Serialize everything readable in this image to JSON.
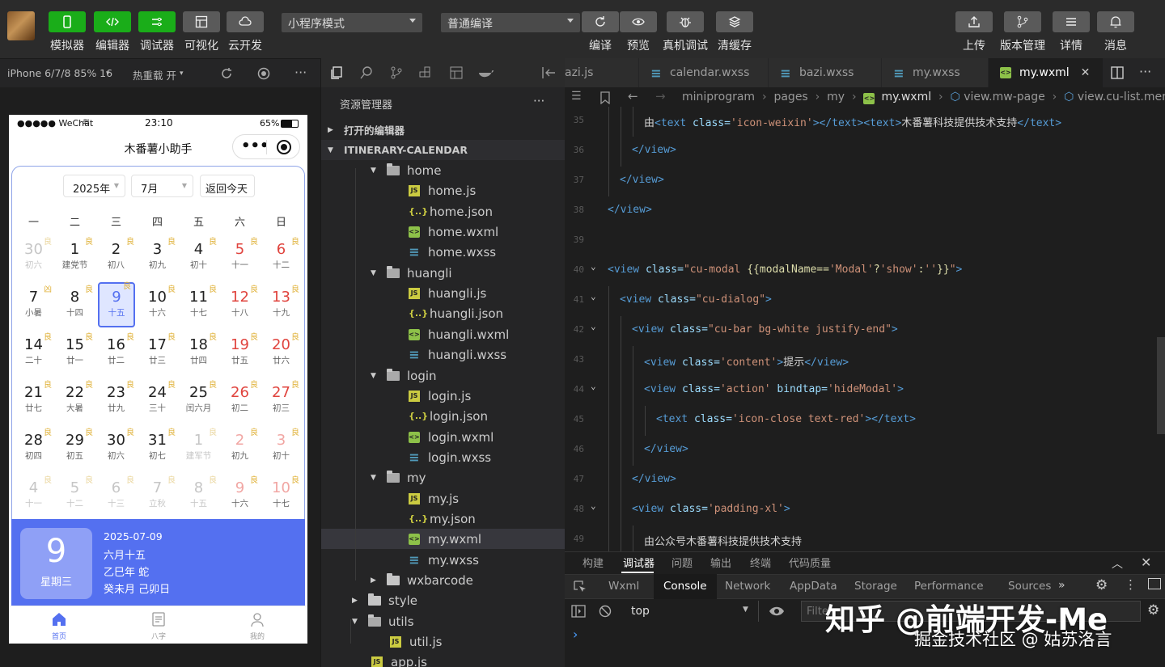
{
  "toolbar": {
    "buttons": [
      {
        "label": "模拟器",
        "icon": "phone-icon"
      },
      {
        "label": "编辑器",
        "icon": "code-icon"
      },
      {
        "label": "调试器",
        "icon": "debug-icon"
      },
      {
        "label": "可视化",
        "icon": "layout-icon"
      },
      {
        "label": "云开发",
        "icon": "cloud-icon"
      }
    ],
    "mode_select": "小程序模式",
    "compile_select": "普通编译",
    "actions": [
      {
        "label": "编译",
        "icon": "refresh-icon"
      },
      {
        "label": "预览",
        "icon": "eye-icon"
      },
      {
        "label": "真机调试",
        "icon": "bug-icon"
      },
      {
        "label": "清缓存",
        "icon": "layers-icon"
      }
    ],
    "right_actions": [
      {
        "label": "上传",
        "icon": "upload-icon"
      },
      {
        "label": "版本管理",
        "icon": "branch-icon"
      },
      {
        "label": "详情",
        "icon": "menu-icon"
      },
      {
        "label": "消息",
        "icon": "bell-icon"
      }
    ]
  },
  "simulator_bar": {
    "device": "iPhone 6/7/8 85% 16",
    "hot_reload": "热重载 开"
  },
  "phone": {
    "status": {
      "carrier": "●●●●● WeChat",
      "time": "23:10",
      "battery": "65%"
    },
    "title": "木番薯小助手",
    "year_select": "2025年",
    "month_select": "7月",
    "today_button": "返回今天",
    "weekdays": [
      "一",
      "二",
      "三",
      "四",
      "五",
      "六",
      "日"
    ],
    "weeks": [
      [
        {
          "n": "30",
          "l": "初六",
          "b": "良",
          "s": "dim"
        },
        {
          "n": "1",
          "l": "建党节",
          "b": "良"
        },
        {
          "n": "2",
          "l": "初八",
          "b": "良"
        },
        {
          "n": "3",
          "l": "初九",
          "b": "良"
        },
        {
          "n": "4",
          "l": "初十",
          "b": "良"
        },
        {
          "n": "5",
          "l": "十一",
          "b": "良",
          "s": "weekend"
        },
        {
          "n": "6",
          "l": "十二",
          "b": "良",
          "s": "weekend"
        }
      ],
      [
        {
          "n": "7",
          "l": "小暑",
          "b": "凶"
        },
        {
          "n": "8",
          "l": "十四",
          "b": "良"
        },
        {
          "n": "9",
          "l": "十五",
          "b": "良",
          "s": "sel"
        },
        {
          "n": "10",
          "l": "十六",
          "b": "良"
        },
        {
          "n": "11",
          "l": "十七",
          "b": "良"
        },
        {
          "n": "12",
          "l": "十八",
          "b": "良",
          "s": "weekend"
        },
        {
          "n": "13",
          "l": "十九",
          "b": "良",
          "s": "weekend"
        }
      ],
      [
        {
          "n": "14",
          "l": "二十",
          "b": "良"
        },
        {
          "n": "15",
          "l": "廿一",
          "b": "良"
        },
        {
          "n": "16",
          "l": "廿二",
          "b": "良"
        },
        {
          "n": "17",
          "l": "廿三",
          "b": "良"
        },
        {
          "n": "18",
          "l": "廿四",
          "b": "良"
        },
        {
          "n": "19",
          "l": "廿五",
          "b": "良",
          "s": "weekend"
        },
        {
          "n": "20",
          "l": "廿六",
          "b": "良",
          "s": "weekend"
        }
      ],
      [
        {
          "n": "21",
          "l": "廿七",
          "b": "良"
        },
        {
          "n": "22",
          "l": "大暑",
          "b": "良"
        },
        {
          "n": "23",
          "l": "廿九",
          "b": "良"
        },
        {
          "n": "24",
          "l": "三十",
          "b": "良"
        },
        {
          "n": "25",
          "l": "闰六月",
          "b": "良"
        },
        {
          "n": "26",
          "l": "初二",
          "b": "良",
          "s": "weekend"
        },
        {
          "n": "27",
          "l": "初三",
          "b": "良",
          "s": "weekend"
        }
      ],
      [
        {
          "n": "28",
          "l": "初四",
          "b": "良"
        },
        {
          "n": "29",
          "l": "初五",
          "b": "良"
        },
        {
          "n": "30",
          "l": "初六",
          "b": "良"
        },
        {
          "n": "31",
          "l": "初七",
          "b": "良"
        },
        {
          "n": "1",
          "l": "建军节",
          "b": "良",
          "s": "dim"
        },
        {
          "n": "2",
          "l": "初九",
          "b": "良",
          "s": "dimwk"
        },
        {
          "n": "3",
          "l": "初十",
          "b": "良",
          "s": "dimwk"
        }
      ],
      [
        {
          "n": "4",
          "l": "十一",
          "b": "良",
          "s": "dim"
        },
        {
          "n": "5",
          "l": "十二",
          "b": "良",
          "s": "dim"
        },
        {
          "n": "6",
          "l": "十三",
          "b": "良",
          "s": "dim"
        },
        {
          "n": "7",
          "l": "立秋",
          "b": "良",
          "s": "dim"
        },
        {
          "n": "8",
          "l": "十五",
          "b": "良",
          "s": "dim"
        },
        {
          "n": "9",
          "l": "十六",
          "b": "良",
          "s": "dimwk"
        },
        {
          "n": "10",
          "l": "十七",
          "b": "良",
          "s": "dimwk"
        }
      ]
    ],
    "info": {
      "big_day": "9",
      "weekday": "星期三",
      "date": "2025-07-09",
      "lunar": "六月十五",
      "year_gz": "乙巳年 蛇",
      "month_gz": "癸未月 己卯日"
    },
    "tabbar": [
      {
        "label": "首页",
        "icon": "home-icon"
      },
      {
        "label": "八字",
        "icon": "document-icon"
      },
      {
        "label": "我的",
        "icon": "user-icon"
      }
    ]
  },
  "explorer": {
    "title": "资源管理器",
    "more": "···",
    "open_editors": "打开的编辑器",
    "project": "ITINERARY-CALENDAR",
    "tree": [
      {
        "label": "home",
        "type": "folder",
        "depth": 1,
        "open": true
      },
      {
        "label": "home.js",
        "type": "js",
        "depth": 2
      },
      {
        "label": "home.json",
        "type": "json",
        "depth": 2
      },
      {
        "label": "home.wxml",
        "type": "wxml",
        "depth": 2
      },
      {
        "label": "home.wxss",
        "type": "wxss",
        "depth": 2
      },
      {
        "label": "huangli",
        "type": "folder",
        "depth": 1,
        "open": true
      },
      {
        "label": "huangli.js",
        "type": "js",
        "depth": 2
      },
      {
        "label": "huangli.json",
        "type": "json",
        "depth": 2
      },
      {
        "label": "huangli.wxml",
        "type": "wxml",
        "depth": 2
      },
      {
        "label": "huangli.wxss",
        "type": "wxss",
        "depth": 2
      },
      {
        "label": "login",
        "type": "folder",
        "depth": 1,
        "open": true
      },
      {
        "label": "login.js",
        "type": "js",
        "depth": 2
      },
      {
        "label": "login.json",
        "type": "json",
        "depth": 2
      },
      {
        "label": "login.wxml",
        "type": "wxml",
        "depth": 2
      },
      {
        "label": "login.wxss",
        "type": "wxss",
        "depth": 2
      },
      {
        "label": "my",
        "type": "folder",
        "depth": 1,
        "open": true
      },
      {
        "label": "my.js",
        "type": "js",
        "depth": 2
      },
      {
        "label": "my.json",
        "type": "json",
        "depth": 2
      },
      {
        "label": "my.wxml",
        "type": "wxml",
        "depth": 2,
        "selected": true
      },
      {
        "label": "my.wxss",
        "type": "wxss",
        "depth": 2
      },
      {
        "label": "wxbarcode",
        "type": "folder",
        "depth": 1,
        "open": false
      },
      {
        "label": "style",
        "type": "folder",
        "depth": 0,
        "open": false
      },
      {
        "label": "utils",
        "type": "folder",
        "depth": 0,
        "open": true
      },
      {
        "label": "util.js",
        "type": "js",
        "depth": 1
      },
      {
        "label": "app.js",
        "type": "js",
        "depth": 0
      }
    ]
  },
  "editor": {
    "tabs": [
      {
        "label": "azi.js",
        "icon": "js"
      },
      {
        "label": "calendar.wxss",
        "icon": "wxss"
      },
      {
        "label": "bazi.wxss",
        "icon": "wxss"
      },
      {
        "label": "my.wxss",
        "icon": "wxss"
      },
      {
        "label": "my.wxml",
        "icon": "wxml",
        "active": true
      }
    ],
    "breadcrumb": [
      "miniprogram",
      "pages",
      "my",
      "my.wxml",
      "view.mw-page",
      "view.cu-list.menu.ca"
    ],
    "lines": [
      {
        "n": "35",
        "indent": 3,
        "parts": [
          [
            "txt",
            "由"
          ],
          [
            "tag",
            "<text "
          ],
          [
            "attr",
            "class="
          ],
          [
            "str",
            "'icon-weixin'"
          ],
          [
            "tag",
            "></text><text>"
          ],
          [
            "txt",
            "木番薯科技提供技术支持"
          ],
          [
            "tag",
            "</text>"
          ]
        ]
      },
      {
        "n": "36",
        "indent": 2,
        "parts": [
          [
            "tag",
            "</view>"
          ]
        ]
      },
      {
        "n": "37",
        "indent": 1,
        "parts": [
          [
            "tag",
            "</view>"
          ]
        ]
      },
      {
        "n": "38",
        "indent": 0,
        "parts": [
          [
            "tag",
            "</view>"
          ]
        ]
      },
      {
        "n": "39",
        "indent": 0,
        "parts": []
      },
      {
        "n": "40",
        "indent": 0,
        "fold": true,
        "parts": [
          [
            "tag",
            "<view "
          ],
          [
            "attr",
            "class="
          ],
          [
            "str",
            "\"cu-modal "
          ],
          [
            "mus",
            "{{modalName=="
          ],
          [
            "str",
            "'Modal'"
          ],
          [
            "mus",
            "?"
          ],
          [
            "str",
            "'show'"
          ],
          [
            "mus",
            ":"
          ],
          [
            "str",
            "''"
          ],
          [
            "mus",
            "}}"
          ],
          [
            "str",
            "\""
          ],
          [
            "tag",
            ">"
          ]
        ]
      },
      {
        "n": "41",
        "indent": 1,
        "fold": true,
        "parts": [
          [
            "tag",
            "<view "
          ],
          [
            "attr",
            "class="
          ],
          [
            "str",
            "\"cu-dialog\""
          ],
          [
            "tag",
            ">"
          ]
        ]
      },
      {
        "n": "42",
        "indent": 2,
        "fold": true,
        "parts": [
          [
            "tag",
            "<view "
          ],
          [
            "attr",
            "class="
          ],
          [
            "str",
            "\"cu-bar bg-white justify-end\""
          ],
          [
            "tag",
            ">"
          ]
        ]
      },
      {
        "n": "43",
        "indent": 3,
        "parts": [
          [
            "tag",
            "<view "
          ],
          [
            "attr",
            "class="
          ],
          [
            "str",
            "'content'"
          ],
          [
            "tag",
            ">"
          ],
          [
            "txt",
            "提示"
          ],
          [
            "tag",
            "</view>"
          ]
        ]
      },
      {
        "n": "44",
        "indent": 3,
        "fold": true,
        "parts": [
          [
            "tag",
            "<view "
          ],
          [
            "attr",
            "class="
          ],
          [
            "str",
            "'action' "
          ],
          [
            "attr",
            "bindtap="
          ],
          [
            "str",
            "'hideModal'"
          ],
          [
            "tag",
            ">"
          ]
        ]
      },
      {
        "n": "45",
        "indent": 4,
        "parts": [
          [
            "tag",
            "<text "
          ],
          [
            "attr",
            "class="
          ],
          [
            "str",
            "'icon-close text-red'"
          ],
          [
            "tag",
            "></text>"
          ]
        ]
      },
      {
        "n": "46",
        "indent": 3,
        "parts": [
          [
            "tag",
            "</view>"
          ]
        ]
      },
      {
        "n": "47",
        "indent": 2,
        "parts": [
          [
            "tag",
            "</view>"
          ]
        ]
      },
      {
        "n": "48",
        "indent": 2,
        "fold": true,
        "parts": [
          [
            "tag",
            "<view "
          ],
          [
            "attr",
            "class="
          ],
          [
            "str",
            "'padding-xl'"
          ],
          [
            "tag",
            ">"
          ]
        ]
      },
      {
        "n": "49",
        "indent": 3,
        "parts": [
          [
            "txt",
            "由公众号木番薯科技提供技术支持"
          ]
        ]
      }
    ]
  },
  "devtools": {
    "top_tabs": [
      "构建",
      "调试器",
      "问题",
      "输出",
      "终端",
      "代码质量"
    ],
    "panel_tabs": [
      "Wxml",
      "Console",
      "Network",
      "AppData",
      "Storage",
      "Performance",
      "Sources"
    ],
    "more_tabs": "»",
    "context": "top",
    "filter_placeholder": "Filter",
    "prompt": "›"
  },
  "watermark": {
    "main": "知乎 @前端开发-Me",
    "sub": "掘金技术社区 @ 姑苏洛言"
  },
  "colors": {
    "accent": "#5470f0",
    "green": "#1aad19"
  }
}
